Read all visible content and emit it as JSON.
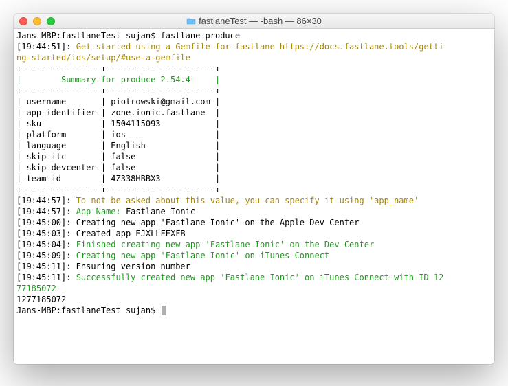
{
  "window": {
    "title": "fastlaneTest — -bash — 86×30",
    "folder_name": "fastlaneTest"
  },
  "prompt1": {
    "host": "Jans-MBP:fastlaneTest sujan$ ",
    "command": "fastlane produce"
  },
  "lines": {
    "ts1": "[19:44:51]: ",
    "msg1a": "Get started using a Gemfile for fastlane https://docs.fastlane.tools/getti",
    "msg1b": "ng-started/ios/setup/#use-a-gemfile",
    "blank": "",
    "tborder": "+----------------+----------------------+",
    "theader": "|        Summary for produce 2.54.4     |",
    "tr1": "| username       | piotrowski@gmail.com |",
    "tr2": "| app_identifier | zone.ionic.fastlane  |",
    "tr3": "| sku            | 1504115093           |",
    "tr4": "| platform       | ios                  |",
    "tr5": "| language       | English              |",
    "tr6": "| skip_itc       | false                |",
    "tr7": "| skip_devcenter | false                |",
    "tr8": "| team_id        | 4Z338HBBX3           |",
    "ts2": "[19:44:57]: ",
    "msg2": "To not be asked about this value, you can specify it using 'app_name'",
    "ts3": "[19:44:57]: ",
    "msg3a": "App Name: ",
    "msg3b": "Fastlane Ionic",
    "ts4": "[19:45:00]: ",
    "msg4": "Creating new app 'Fastlane Ionic' on the Apple Dev Center",
    "ts5": "[19:45:03]: ",
    "msg5": "Created app EJXLLFEXFB",
    "ts6": "[19:45:04]: ",
    "msg6": "Finished creating new app 'Fastlane Ionic' on the Dev Center",
    "ts7": "[19:45:09]: ",
    "msg7": "Creating new app 'Fastlane Ionic' on iTunes Connect",
    "ts8": "[19:45:11]: ",
    "msg8": "Ensuring version number",
    "ts9": "[19:45:11]: ",
    "msg9a": "Successfully created new app 'Fastlane Ionic' on iTunes Connect with ID 12",
    "msg9b": "77185072",
    "id_echo": "1277185072"
  },
  "prompt2": {
    "host": "Jans-MBP:fastlaneTest sujan$ "
  }
}
